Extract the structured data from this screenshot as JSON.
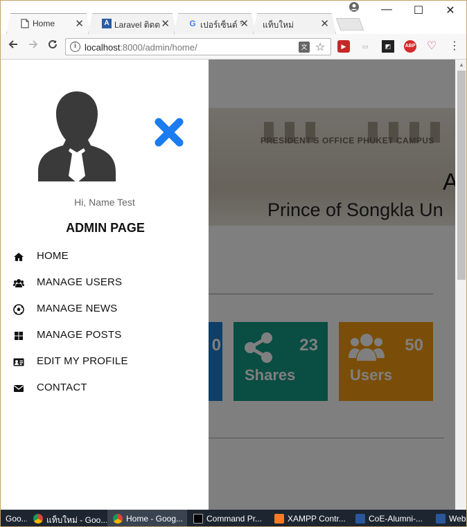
{
  "browser": {
    "tabs": [
      {
        "title": "Home",
        "favicon": "page-icon",
        "active": true
      },
      {
        "title": "Laravel ติดต",
        "favicon": "laravel-icon",
        "active": false
      },
      {
        "title": "เปอร์เซ็นต์ วิ",
        "favicon": "google-icon",
        "active": false
      },
      {
        "title": "แท็บใหม่",
        "favicon": "none",
        "active": false
      }
    ],
    "url_host": "localhost",
    "url_path": ":8000/admin/home/",
    "window_controls": {
      "minimize": "—",
      "maximize": "☐",
      "close": "✕"
    }
  },
  "sidebar": {
    "greeting": "Hi, Name Test",
    "title": "ADMIN PAGE",
    "menu": [
      {
        "label": "HOME",
        "icon": "home-icon"
      },
      {
        "label": "MANAGE USERS",
        "icon": "users-icon"
      },
      {
        "label": "MANAGE NEWS",
        "icon": "soccer-ball-icon"
      },
      {
        "label": "MANAGE POSTS",
        "icon": "grid-icon"
      },
      {
        "label": "EDIT MY PROFILE",
        "icon": "id-card-icon"
      },
      {
        "label": "CONTACT",
        "icon": "envelope-icon"
      }
    ],
    "close_color": "#1a7cf0"
  },
  "page": {
    "banner_sign": "PRESIDENT'S OFFICE PHUKET CAMPUS",
    "banner_big": "A",
    "banner_sub": "Prince of Songkla Un",
    "cards": [
      {
        "label": "Shares",
        "value": "23",
        "icon": "share-icon",
        "color": "#139b87"
      },
      {
        "label": "Users",
        "value": "50",
        "icon": "users-icon",
        "color": "#f59c11"
      }
    ],
    "partial_card_value": "0"
  },
  "taskbar": [
    {
      "label": "Goo...",
      "icon": "chrome-icon"
    },
    {
      "label": "แท็บใหม่ - Goo...",
      "icon": "chrome-icon"
    },
    {
      "label": "Home - Goog...",
      "icon": "chrome-icon",
      "active": true
    },
    {
      "label": "Command Pr...",
      "icon": "cmd-icon"
    },
    {
      "label": "XAMPP Contr...",
      "icon": "xampp-icon"
    },
    {
      "label": "CoE-Alumni-...",
      "icon": "word-icon"
    },
    {
      "label": "WebA",
      "icon": "word-icon"
    }
  ]
}
